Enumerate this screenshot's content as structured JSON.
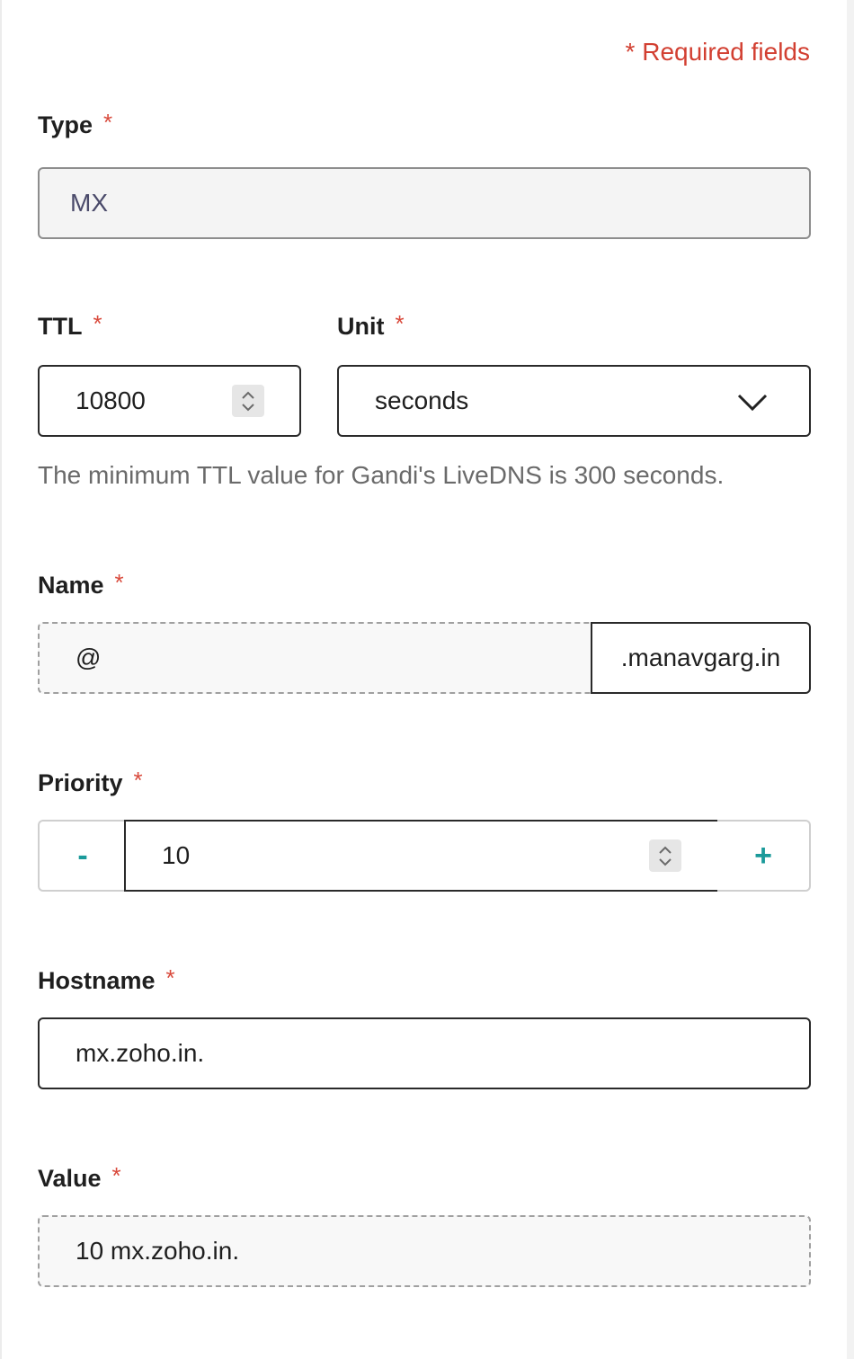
{
  "form": {
    "required_note": "* Required fields",
    "required_marker": "*",
    "type": {
      "label": "Type",
      "value": "MX"
    },
    "ttl": {
      "label": "TTL",
      "value": "10800"
    },
    "unit": {
      "label": "Unit",
      "selected": "seconds"
    },
    "ttl_helper": "The minimum TTL value for Gandi's LiveDNS is 300 seconds.",
    "name": {
      "label": "Name",
      "value": "@",
      "suffix": ".manavgarg.in"
    },
    "priority": {
      "label": "Priority",
      "value": "10",
      "decrement_label": "-",
      "increment_label": "+"
    },
    "hostname": {
      "label": "Hostname",
      "value": "mx.zoho.in."
    },
    "value": {
      "label": "Value",
      "value": "10 mx.zoho.in."
    }
  },
  "colors": {
    "required_red": "#d23f31",
    "stepper_teal": "#1a9a9a",
    "border_dark": "#2a2a2a",
    "readonly_bg": "#f4f4f4"
  },
  "icons": {
    "spinner": "spinner-arrows-icon",
    "dropdown": "chevron-down-icon"
  }
}
